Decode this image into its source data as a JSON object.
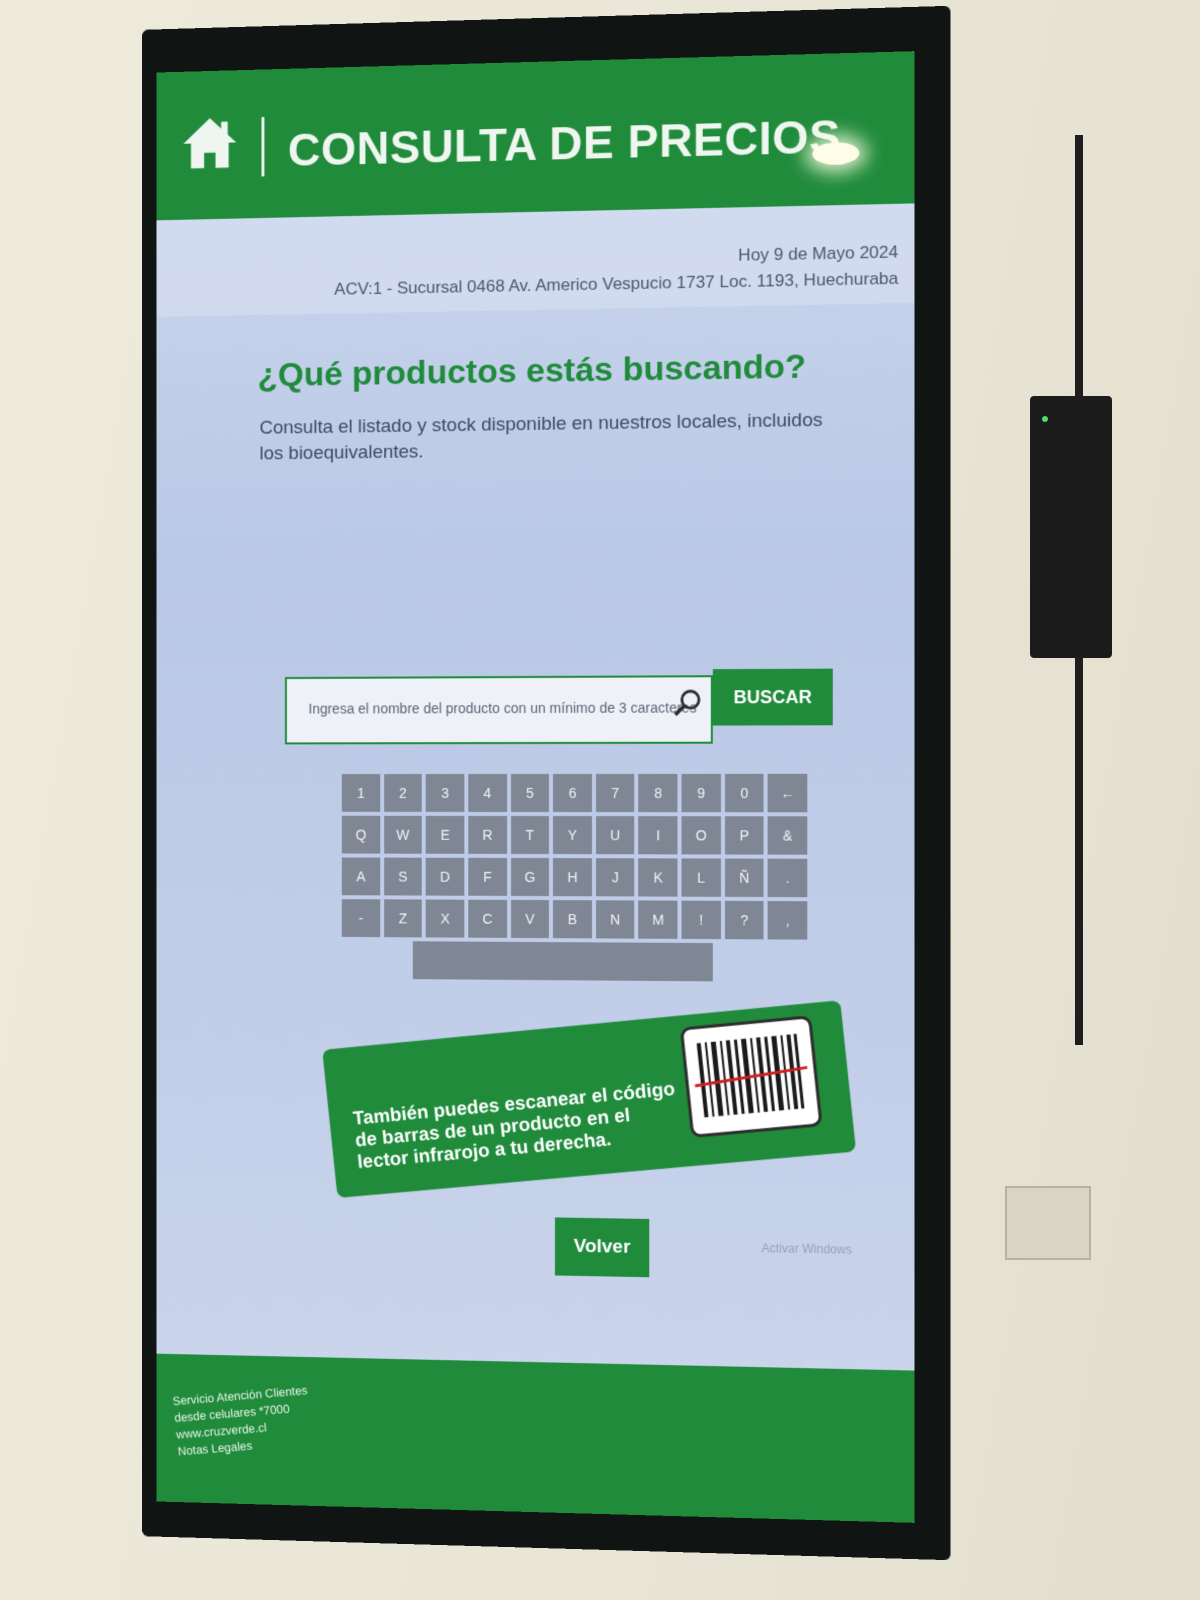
{
  "header": {
    "title": "CONSULTA DE PRECIOS",
    "icons": {
      "home": "home-icon"
    }
  },
  "subheader": {
    "date": "Hoy 9 de Mayo 2024",
    "branch": "ACV:1 - Sucursal 0468 Av. Americo Vespucio 1737 Loc. 1193, Huechuraba"
  },
  "main": {
    "question": "¿Qué productos estás buscando?",
    "description": "Consulta el listado y stock disponible en nuestros locales, incluidos los bioequivalentes."
  },
  "search": {
    "placeholder": "Ingresa el nombre del producto con un mínimo de 3 caracteres",
    "button_label": "BUSCAR",
    "icon": "search-icon"
  },
  "keyboard": {
    "rows": [
      [
        "1",
        "2",
        "3",
        "4",
        "5",
        "6",
        "7",
        "8",
        "9",
        "0",
        "←"
      ],
      [
        "Q",
        "W",
        "E",
        "R",
        "T",
        "Y",
        "U",
        "I",
        "O",
        "P",
        "&"
      ],
      [
        "A",
        "S",
        "D",
        "F",
        "G",
        "H",
        "J",
        "K",
        "L",
        "Ñ",
        "."
      ],
      [
        "-",
        "Z",
        "X",
        "C",
        "V",
        "B",
        "N",
        "M",
        "!",
        "?",
        ","
      ]
    ]
  },
  "promo": {
    "text": "También puedes escanear el código de barras de un producto en el lector infrarojo a tu derecha.",
    "icon": "barcode-icon"
  },
  "back_button": "Volver",
  "watermark": "Activar Windows",
  "footer": {
    "line1": "Servicio Atención Clientes",
    "line2": "desde celulares *7000",
    "line3": "www.cruzverde.cl",
    "line4": "Notas Legales"
  },
  "colors": {
    "brand_green": "#1f8b3b",
    "key_gray": "#7f8694"
  }
}
